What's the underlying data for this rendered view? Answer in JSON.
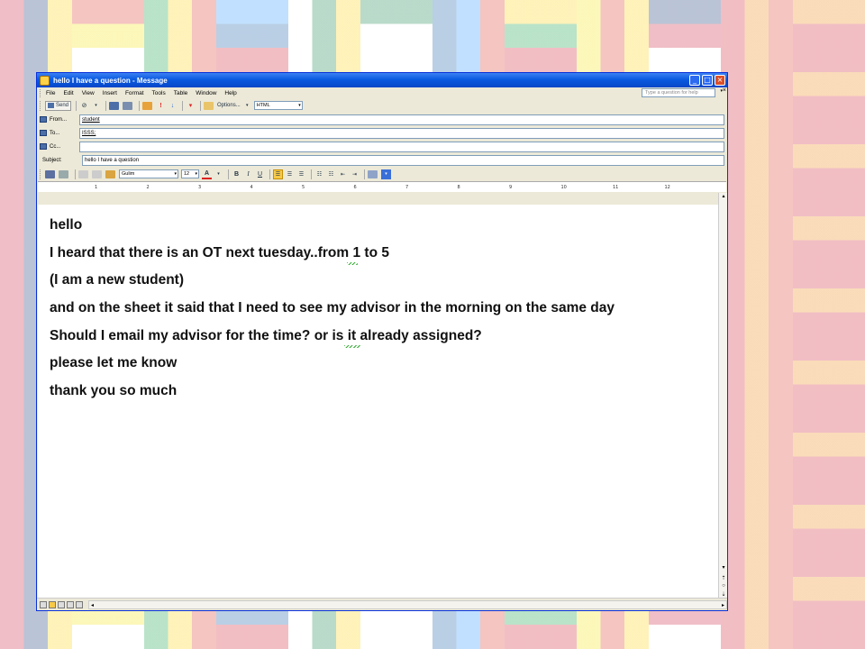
{
  "window": {
    "title": "hello I have a question - Message"
  },
  "menu": {
    "items": [
      "File",
      "Edit",
      "View",
      "Insert",
      "Format",
      "Tools",
      "Table",
      "Window",
      "Help"
    ],
    "help_placeholder": "Type a question for help",
    "close_glyph": "×"
  },
  "toolbar": {
    "send_label": "Send",
    "options_label": "Options...",
    "format_value": "HTML"
  },
  "header": {
    "from_label": "From...",
    "from_value": "student",
    "to_label": "To...",
    "to_value": "ISSS;",
    "cc_label": "Cc...",
    "cc_value": "",
    "subject_label": "Subject:",
    "subject_value": "hello I have a question"
  },
  "formatting": {
    "font": "Gulim",
    "size": "12",
    "bold": "B",
    "italic": "I",
    "underline": "U"
  },
  "ruler": {
    "numbers": [
      "1",
      "2",
      "3",
      "4",
      "5",
      "6",
      "7",
      "8",
      "9",
      "10",
      "11",
      "12"
    ]
  },
  "body": {
    "lines": [
      "hello",
      "I heard that there is an OT next tuesday..from 1 to 5",
      "(I am a new student)",
      "and on the sheet it said that I need to see my advisor in the morning on the same day",
      "Should I email my advisor for the time? or is it already assigned?",
      "please let me know",
      "thank you so much"
    ]
  },
  "colors": {
    "title_bar": "#0a5ae0",
    "chrome": "#ece9d8",
    "close_button": "#d9502a"
  },
  "icons": [
    "outlook-message-icon",
    "minimize-icon",
    "maximize-icon",
    "close-icon",
    "send-icon",
    "attach-icon",
    "address-book-icon",
    "check-names-icon",
    "importance-high-icon",
    "importance-low-icon",
    "flag-icon",
    "options-icon",
    "save-icon",
    "print-icon",
    "cut-icon",
    "copy-icon",
    "paste-icon",
    "align-left-icon",
    "center-icon",
    "align-right-icon",
    "numbering-icon",
    "bullets-icon",
    "decrease-indent-icon",
    "increase-indent-icon",
    "font-color-icon"
  ]
}
